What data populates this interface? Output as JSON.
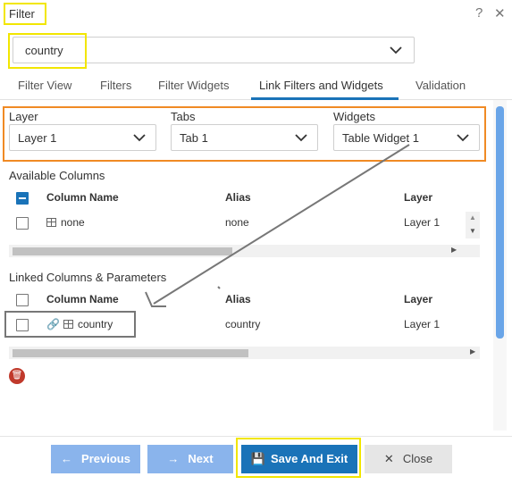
{
  "dialog": {
    "title": "Filter",
    "help_icon": "?",
    "close_icon": "✕"
  },
  "filter_select": {
    "value": "country"
  },
  "tabs": [
    {
      "label": "Filter View"
    },
    {
      "label": "Filters"
    },
    {
      "label": "Filter Widgets"
    },
    {
      "label": "Link Filters and Widgets",
      "active": true
    },
    {
      "label": "Validation"
    }
  ],
  "selectors": {
    "layer": {
      "label": "Layer",
      "value": "Layer 1"
    },
    "tabs": {
      "label": "Tabs",
      "value": "Tab 1"
    },
    "widgets": {
      "label": "Widgets",
      "value": "Table Widget 1"
    }
  },
  "available_columns": {
    "title": "Available Columns",
    "headers": [
      "Column Name",
      "Alias",
      "Layer"
    ],
    "rows": [
      {
        "name": "none",
        "alias": "none",
        "layer": "Layer 1"
      }
    ]
  },
  "linked_columns": {
    "title": "Linked Columns & Parameters",
    "headers": [
      "Column Name",
      "Alias",
      "Layer"
    ],
    "rows": [
      {
        "name": "country",
        "alias": "country",
        "layer": "Layer 1"
      }
    ]
  },
  "footer": {
    "previous": "Previous",
    "next": "Next",
    "save_and_exit": "Save And Exit",
    "close": "Close"
  },
  "colors": {
    "primary": "#1a73b8",
    "disabled_button": "#8ab4ec",
    "highlight_yellow": "#f2e600",
    "highlight_orange": "#f08a24",
    "delete": "#c0392b"
  }
}
